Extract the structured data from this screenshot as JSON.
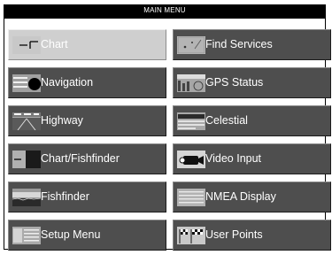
{
  "title": "MAIN MENU",
  "left_column": [
    {
      "label": "Chart",
      "icon": "chart-icon",
      "selected": true
    },
    {
      "label": "Navigation",
      "icon": "navigation-icon",
      "selected": false
    },
    {
      "label": "Highway",
      "icon": "highway-icon",
      "selected": false
    },
    {
      "label": "Chart/Fishfinder",
      "icon": "chart-fishfinder-icon",
      "selected": false
    },
    {
      "label": "Fishfinder",
      "icon": "fishfinder-icon",
      "selected": false
    },
    {
      "label": "Setup Menu",
      "icon": "setup-menu-icon",
      "selected": false
    }
  ],
  "right_column": [
    {
      "label": "Find Services",
      "icon": "find-services-icon",
      "selected": false
    },
    {
      "label": "GPS Status",
      "icon": "gps-status-icon",
      "selected": false
    },
    {
      "label": "Celestial",
      "icon": "celestial-icon",
      "selected": false
    },
    {
      "label": "Video Input",
      "icon": "video-camera-icon",
      "selected": false
    },
    {
      "label": "NMEA Display",
      "icon": "nmea-display-icon",
      "selected": false
    },
    {
      "label": "User Points",
      "icon": "user-points-flags-icon",
      "selected": false
    }
  ],
  "colors": {
    "frame": "#000000",
    "button": "#4e4e4e",
    "button_selected": "#cfcfcf",
    "label": "#ffffff"
  }
}
